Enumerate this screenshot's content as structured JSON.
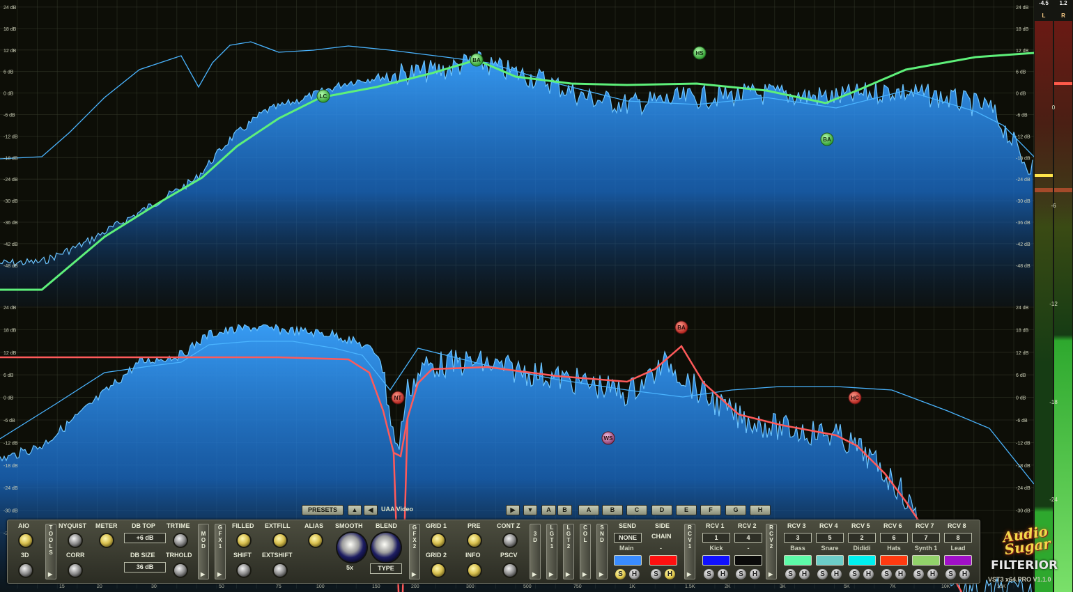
{
  "spectrum": {
    "upper_db_labels": [
      "24 dB",
      "18 dB",
      "12 dB",
      "6 dB",
      "0 dB",
      "-6 dB",
      "-12 dB",
      "-18 dB",
      "-24 dB",
      "-30 dB",
      "-36 dB",
      "-42 dB",
      "-48 dB"
    ],
    "lower_db_labels": [
      "24 dB",
      "18 dB",
      "12 dB",
      "6 dB",
      "0 dB",
      "-6 dB",
      "-12 dB",
      "-18 dB",
      "-24 dB",
      "-30 dB",
      "-36 dB"
    ],
    "freq_labels": [
      "15",
      "20",
      "30",
      "50",
      "75",
      "100",
      "150",
      "200",
      "300",
      "500",
      "750",
      "1K",
      "1.5K",
      "2K",
      "3K",
      "5K",
      "7K",
      "10K",
      "15K"
    ],
    "upper_nodes": [
      "LC",
      "BA",
      "HS",
      "BA"
    ],
    "lower_nodes": [
      "NT",
      "WS",
      "BA",
      "HC"
    ],
    "colors": {
      "upper_curve": "#5ef07a",
      "lower_curve": "#ff5a5a",
      "spectrum_fill": "#1b8cff",
      "spectrum_line": "#3ea8ff",
      "background": "#0d0e07",
      "grid": "#3a3f30"
    }
  },
  "meter": {
    "left_peak": "-4.5",
    "right_peak": "1.2",
    "left_label": "L",
    "right_label": "R",
    "scale": [
      "0",
      "-6",
      "-12",
      "-18",
      "-24"
    ]
  },
  "toolbar": {
    "presets_label": "PRESETS",
    "preset_name": "UAA Video",
    "slots_left": [
      "A",
      "B"
    ],
    "slots_right": [
      "A",
      "B",
      "C",
      "D",
      "E",
      "F",
      "G",
      "H"
    ]
  },
  "panel": {
    "aio": "AIO",
    "three_d": "3D",
    "tools_tab": "TOOLS",
    "nyquist": "NYQUIST",
    "corr": "CORR",
    "meter": "METER",
    "db_top": "DB TOP",
    "db_top_value": "+6 dB",
    "db_size": "DB SIZE",
    "db_size_value": "36 dB",
    "trtime": "TRTIME",
    "trhold": "TRHOLD",
    "mod_tab": "MOD",
    "gfx1_tab": "GFX1",
    "filled": "FILLED",
    "extfill": "EXTFILL",
    "shift": "SHIFT",
    "extshift": "EXTSHIFT",
    "alias": "ALIAS",
    "smooth": "SMOOTH",
    "smooth_value": "5x",
    "blend": "BLEND",
    "type": "TYPE",
    "gfx2_tab": "GFX2",
    "grid1": "GRID 1",
    "grid2": "GRID 2",
    "pre": "PRE",
    "info": "INFO",
    "contz": "CONT Z",
    "pscv": "PSCV",
    "vtabs": [
      "3D",
      "LGT1",
      "LGT2",
      "COL",
      "SND"
    ],
    "send": "SEND",
    "send_value": "NONE",
    "send_name": "Main",
    "sidechain": "SIDE",
    "sidechain2": "CHAIN",
    "sidechain_value": "-",
    "rcv1_tab": "RCV1",
    "rcv2_tab": "RCV2",
    "receivers": [
      {
        "label": "RCV 1",
        "num": "1",
        "name": "Kick",
        "color": "#1010ff"
      },
      {
        "label": "RCV 2",
        "num": "4",
        "name": "-",
        "color": "#0a0a0a"
      },
      {
        "label": "RCV 3",
        "num": "3",
        "name": "Bass",
        "color": "#5dfaa8"
      },
      {
        "label": "RCV 4",
        "num": "5",
        "name": "Snare",
        "color": "#6ccdc8"
      },
      {
        "label": "RCV 5",
        "num": "2",
        "name": "Dididi",
        "color": "#00f0f0"
      },
      {
        "label": "RCV 6",
        "num": "6",
        "name": "Hats",
        "color": "#ff3a10"
      },
      {
        "label": "RCV 7",
        "num": "7",
        "name": "Synth 1",
        "color": "#92d26a"
      },
      {
        "label": "RCV 8",
        "num": "8",
        "name": "Lead",
        "color": "#a010c8"
      }
    ],
    "send_color": "#3a8cff",
    "sidechain_color": "#ff1010",
    "s_label": "S",
    "h_label": "H"
  },
  "logo": {
    "script": "Audio Sugar",
    "name": "FILTERIOR",
    "version": "VST3 x64.PRO V1.1.0"
  }
}
